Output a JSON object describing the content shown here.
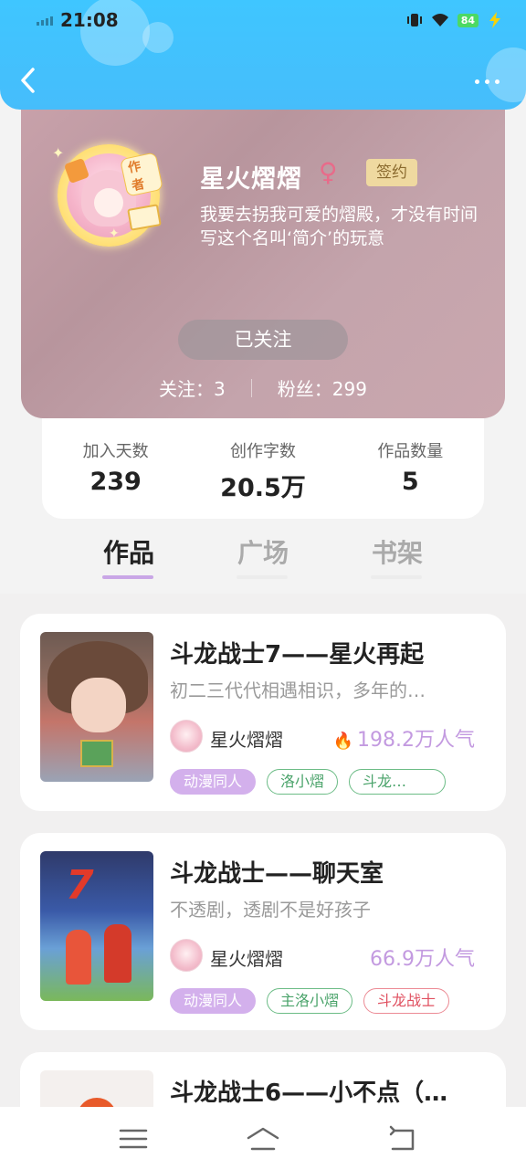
{
  "status_bar": {
    "time": "21:08",
    "battery": "84"
  },
  "profile": {
    "name": "星火熠熠",
    "gender_symbol": "♀",
    "badge": "签约",
    "author_tag": "作者",
    "bio": "我要去拐我可爱的熠殿，才没有时间写这个名叫‘简介’的玩意",
    "follow_button": "已关注",
    "following": "关注：3",
    "fans": "粉丝：299"
  },
  "stats": [
    {
      "label": "加入天数",
      "value": "239"
    },
    {
      "label": "创作字数",
      "value": "20.5万"
    },
    {
      "label": "作品数量",
      "value": "5"
    }
  ],
  "tabs": [
    {
      "label": "作品",
      "active": true
    },
    {
      "label": "广场",
      "active": false
    },
    {
      "label": "书架",
      "active": false
    }
  ],
  "works": [
    {
      "title": "斗龙战士7——星火再起",
      "desc": "初二三代代相遇相识，多年的…",
      "author": "星火熠熠",
      "popularity": "198.2万人气",
      "hot": true,
      "tags": [
        {
          "text": "动漫同人",
          "style": "solid"
        },
        {
          "text": "洛小熠",
          "style": "green"
        },
        {
          "text": "斗龙…",
          "style": "green"
        }
      ]
    },
    {
      "title": "斗龙战士——聊天室",
      "desc": "不透剧，透剧不是好孩子",
      "author": "星火熠熠",
      "popularity": "66.9万人气",
      "hot": false,
      "tags": [
        {
          "text": "动漫同人",
          "style": "solid"
        },
        {
          "text": "主洛小熠",
          "style": "green"
        },
        {
          "text": "斗龙战士",
          "style": "red"
        }
      ]
    },
    {
      "title": "斗龙战士6——小不点（…",
      "desc": "",
      "author": "",
      "popularity": "",
      "hot": false,
      "tags": []
    }
  ],
  "icons": {
    "back": "chevron-left-icon",
    "more": "more-dots-icon",
    "menu": "menu-icon",
    "home": "home-icon",
    "return": "return-icon",
    "hot": "fire-icon"
  },
  "colors": {
    "header_blue": "#46bdfb",
    "accent_purple": "#c39ae0",
    "tag_green": "#4aa36a",
    "tag_red": "#e05060"
  }
}
